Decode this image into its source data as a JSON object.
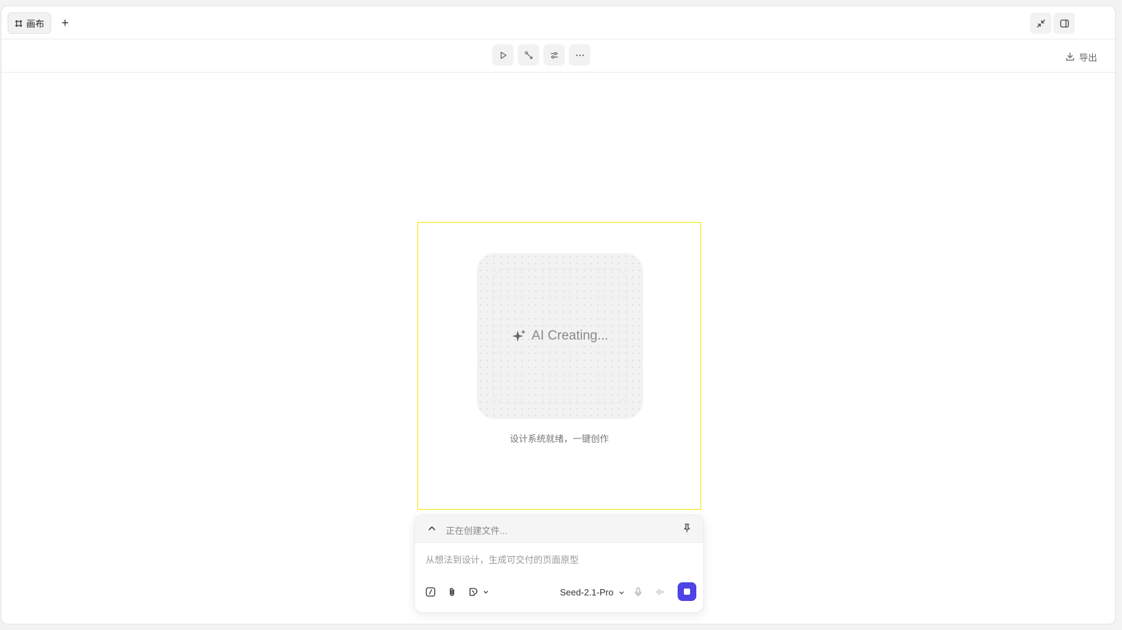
{
  "tabbar": {
    "tab_label": "画布",
    "add_label": "+"
  },
  "toolbar": {
    "tools": [
      "play-icon",
      "connector-icon",
      "adjust-icon",
      "more-icon"
    ],
    "export_label": "导出"
  },
  "canvas": {
    "ai_label": "AI Creating...",
    "ai_sub": "设计系统就绪，一键创作",
    "frame_color": "#f2e600"
  },
  "chat": {
    "status_text": "正在创建文件...",
    "input_placeholder": "从想法到设计，生成可交付的页面原型",
    "model_label": "Seed-2.1-Pro",
    "accent": "#4d43e6"
  }
}
